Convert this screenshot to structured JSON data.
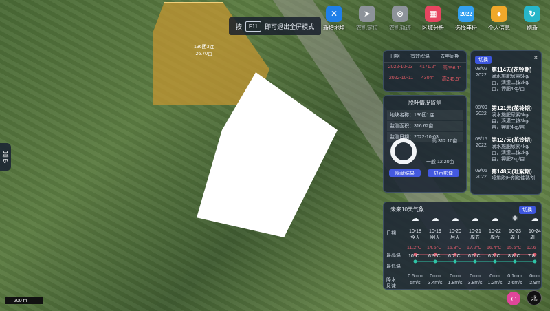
{
  "toast": {
    "pre": "按",
    "key": "F11",
    "post": "即可退出全屏模式"
  },
  "toolbar": [
    {
      "label": "新增地块",
      "color": "#1f7fe8",
      "glyph": "✕",
      "icon": "tools-icon",
      "dim": false
    },
    {
      "label": "农机定位",
      "color": "#8d939a",
      "glyph": "➤",
      "icon": "navigation-icon",
      "dim": true
    },
    {
      "label": "农机轨迹",
      "color": "#8d939a",
      "glyph": "⊙",
      "icon": "location-pin-icon",
      "dim": true
    },
    {
      "label": "区域分析",
      "color": "#e74560",
      "glyph": "▦",
      "icon": "grid-icon",
      "dim": false
    },
    {
      "label": "选择年份",
      "color": "#33a0f0",
      "glyph": "2022",
      "icon": "year-icon",
      "dim": false
    },
    {
      "label": "个人信息",
      "color": "#f0a82a",
      "glyph": "●",
      "icon": "user-icon",
      "dim": false
    },
    {
      "label": "刷新",
      "color": "#27b6c9",
      "glyph": "↻",
      "icon": "refresh-icon",
      "dim": false
    }
  ],
  "field_label": {
    "line1": "136团3连",
    "line2": "26.70亩"
  },
  "area_table": {
    "headers": [
      "日期",
      "有效积温",
      "去年同期"
    ],
    "rows": [
      [
        "2022-10-03",
        "4171.2°",
        "高596.1°"
      ],
      [
        "2022-10-11",
        "4304°",
        "高245.5°"
      ]
    ]
  },
  "defol": {
    "title": "脱叶情况监测",
    "name": "地块名称：136团1连",
    "area": "监测面积：316.62亩",
    "date": "监测日期：2022-10-03",
    "high": "高    312.10亩",
    "mid": "一般 12.20亩",
    "btn_hide": "隐藏结果",
    "btn_show": "显示影像"
  },
  "farming": {
    "switch": "切换",
    "close": "×",
    "events": [
      {
        "date": "08/02",
        "year": "2022",
        "title": "第114天(花铃期)",
        "lines": [
          "滴水施肥尿素5kg/",
          "亩，滴灌二铵3kg/",
          "亩，钾肥4kg/亩"
        ]
      },
      {
        "date": "08/09",
        "year": "2022",
        "title": "第121天(花铃期)",
        "lines": [
          "滴水施肥尿素5kg/",
          "亩，滴灌二铵3kg/",
          "亩，钾肥4kg/亩"
        ]
      },
      {
        "date": "08/15",
        "year": "2022",
        "title": "第127天(花铃期)",
        "lines": [
          "滴水施肥尿素4kg/",
          "亩，滴灌二铵2kg/",
          "亩，钾肥2kg/亩"
        ]
      },
      {
        "date": "09/05",
        "year": "2022",
        "title": "第148天(吐絮期)",
        "lines": [
          "喷施脱叶剂和催熟剂"
        ]
      }
    ]
  },
  "weather": {
    "title": "未来10天气象",
    "switch": "切换",
    "label_date": "日期",
    "label_high": "最高温",
    "label_low": "最低温",
    "label_rain": "降水",
    "label_wind": "风速",
    "days": [
      {
        "date": "10-18",
        "day": "今天",
        "hi": "11.2°C",
        "lo": "10°C",
        "rain": "0.5mm",
        "wind": "5m/s",
        "icon": "partly-cloudy-icon"
      },
      {
        "date": "10-19",
        "day": "明天",
        "hi": "14.5°C",
        "lo": "6.9°C",
        "rain": "0mm",
        "wind": "3.4m/s",
        "icon": "partly-cloudy-icon"
      },
      {
        "date": "10-20",
        "day": "后天",
        "hi": "15.3°C",
        "lo": "6.7°C",
        "rain": "0mm",
        "wind": "1.8m/s",
        "icon": "partly-cloudy-icon"
      },
      {
        "date": "10-21",
        "day": "周五",
        "hi": "17.2°C",
        "lo": "6.5°C",
        "rain": "0mm",
        "wind": "3.8m/s",
        "icon": "partly-cloudy-icon"
      },
      {
        "date": "10-22",
        "day": "周六",
        "hi": "16.4°C",
        "lo": "6.3°C",
        "rain": "0mm",
        "wind": "1.2m/s",
        "icon": "partly-cloudy-icon"
      },
      {
        "date": "10-23",
        "day": "周日",
        "hi": "15.5°C",
        "lo": "8.8°C",
        "rain": "0.1mm",
        "wind": "2.6m/s",
        "icon": "snow-cloud-icon"
      },
      {
        "date": "10-24",
        "day": "周一",
        "hi": "12.6",
        "lo": "7.8",
        "rain": "0mm",
        "wind": "2.9m",
        "icon": "partly-cloudy-icon"
      }
    ]
  },
  "side_tab": "显示",
  "scale": "200 m",
  "compass": "北"
}
